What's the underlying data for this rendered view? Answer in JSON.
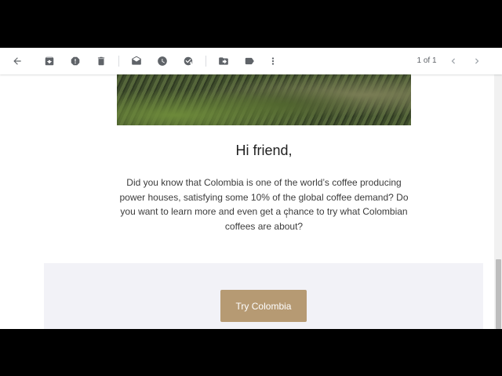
{
  "toolbar": {
    "back_icon": "arrow-left-icon",
    "buttons": [
      {
        "name": "archive",
        "icon": "archive-icon"
      },
      {
        "name": "report-spam",
        "icon": "report-spam-icon"
      },
      {
        "name": "delete",
        "icon": "trash-icon"
      },
      {
        "name": "mark-unread",
        "icon": "envelope-icon"
      },
      {
        "name": "snooze",
        "icon": "clock-icon"
      },
      {
        "name": "add-task",
        "icon": "task-add-icon"
      },
      {
        "name": "move-to",
        "icon": "folder-move-icon"
      },
      {
        "name": "label",
        "icon": "label-icon"
      },
      {
        "name": "more",
        "icon": "more-vert-icon"
      }
    ],
    "pager_text": "1 of 1"
  },
  "email": {
    "greeting": "Hi friend,",
    "body": "Did you know that Colombia is one of the world’s coffee producing power houses, satisfying some 10% of the global coffee demand? Do you want to learn more and even get a chance to try what Colombian coffees are about?",
    "cta_label": "Try Colombia",
    "cta_color": "#b69a73",
    "panel_color": "#f2f2f7"
  }
}
